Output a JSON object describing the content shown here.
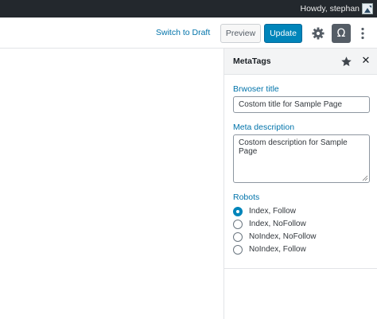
{
  "admin_bar": {
    "greeting": "Howdy, stephan"
  },
  "header": {
    "switch_to_draft": "Switch to Draft",
    "preview": "Preview",
    "update": "Update",
    "omega_symbol": "Ω",
    "icons": [
      "gear-icon",
      "omega-icon",
      "more-vertical-icon"
    ]
  },
  "sidebar": {
    "title": "MetaTags",
    "close_symbol": "✕",
    "browser_title_label": "Brwoser title",
    "browser_title_value": "Costom title for Sample Page",
    "meta_description_label": "Meta description",
    "meta_description_value": "Costom description for Sample Page",
    "robots_label": "Robots",
    "robots_options": [
      {
        "label": "Index, Follow",
        "checked": true
      },
      {
        "label": "Index, NoFollow",
        "checked": false
      },
      {
        "label": "NoIndex, NoFollow",
        "checked": false
      },
      {
        "label": "NoIndex, Follow",
        "checked": false
      }
    ]
  },
  "colors": {
    "admin_bar": "#23282d",
    "link": "#0073aa",
    "primary_button": "#0085ba",
    "active_toggle": "#555d66"
  }
}
